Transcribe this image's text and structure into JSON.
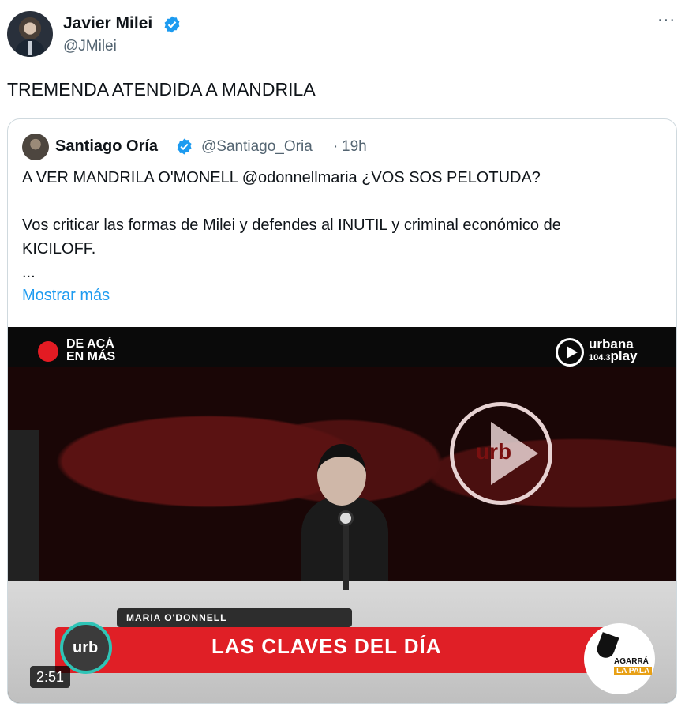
{
  "author": {
    "name": "Javier Milei",
    "handle": "@JMilei",
    "verified_icon": "verified-badge-icon",
    "more_label": "···"
  },
  "tweet": {
    "text": "TREMENDA ATENDIDA A MANDRILA"
  },
  "quote": {
    "name": "Santiago Oría",
    "handle": "@Santiago_Oria",
    "separator": "·",
    "time": "19h",
    "lines": [
      "A VER MANDRILA O'MONELL @odonnellmaria ¿VOS SOS PELOTUDA?",
      "Vos criticar las formas de Milei y defendes al INUTIL y criminal económico de",
      "KICILOFF.",
      "..."
    ],
    "show_more": "Mostrar más"
  },
  "video": {
    "live_label": "DE ACÁ\nEN MÁS",
    "brand_top": "urbana",
    "brand_freq": "104.3",
    "brand_bottom": "play",
    "studio_logo": "urb",
    "name_tag": "MARIA O'DONNELL",
    "lower_third": "LAS CLAVES DEL DÍA",
    "lower_logo": "urb",
    "badge_line1": "AGARRÁ",
    "badge_line2": "LA PALA",
    "duration": "2:51"
  },
  "colors": {
    "accent": "#1d9bf0",
    "verified": "#1d9bf0",
    "text": "#0f1419",
    "muted": "#536471",
    "lower_third_red": "#e01f26"
  }
}
